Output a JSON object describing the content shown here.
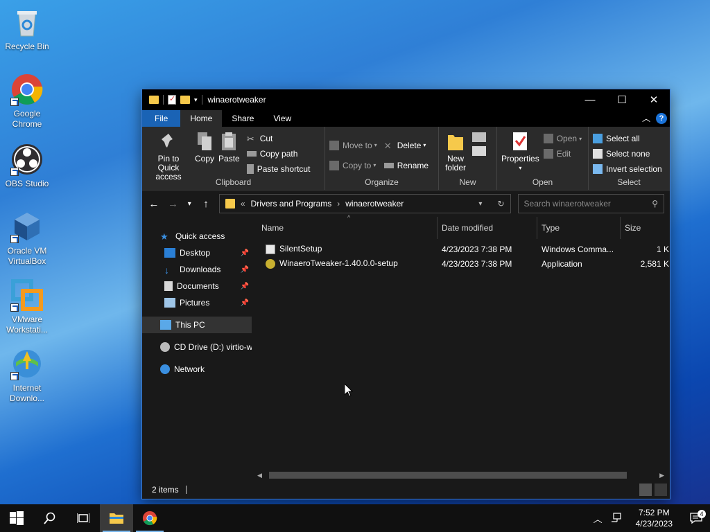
{
  "desktop": {
    "icons": [
      {
        "label": "Recycle Bin",
        "icon": "recycle-bin-icon"
      },
      {
        "label": "Google Chrome",
        "icon": "chrome-icon"
      },
      {
        "label": "OBS Studio",
        "icon": "obs-icon"
      },
      {
        "label": "Oracle VM VirtualBox",
        "icon": "virtualbox-icon"
      },
      {
        "label": "VMware Workstati...",
        "icon": "vmware-icon"
      },
      {
        "label": "Internet Downlo...",
        "icon": "idm-icon"
      }
    ]
  },
  "window": {
    "title": "winaerotweaker",
    "controls": {
      "minimize": "—",
      "maximize": "☐",
      "close": "✕"
    },
    "tabs": [
      "File",
      "Home",
      "Share",
      "View"
    ],
    "active_tab": "Home"
  },
  "ribbon": {
    "clipboard": {
      "label": "Clipboard",
      "pin": "Pin to Quick access",
      "copy": "Copy",
      "paste": "Paste",
      "cut": "Cut",
      "copy_path": "Copy path",
      "paste_shortcut": "Paste shortcut"
    },
    "organize": {
      "label": "Organize",
      "move_to": "Move to",
      "copy_to": "Copy to",
      "delete": "Delete",
      "rename": "Rename"
    },
    "new": {
      "label": "New",
      "new_folder": "New folder"
    },
    "open": {
      "label": "Open",
      "properties": "Properties",
      "open": "Open",
      "edit": "Edit"
    },
    "select": {
      "label": "Select",
      "select_all": "Select all",
      "select_none": "Select none",
      "invert_selection": "Invert selection"
    }
  },
  "address": {
    "prefix": "«",
    "crumbs": [
      "Drivers and Programs",
      "winaerotweaker"
    ],
    "search_placeholder": "Search winaerotweaker"
  },
  "nav": {
    "quick_access": "Quick access",
    "items": [
      {
        "label": "Desktop",
        "pinned": true
      },
      {
        "label": "Downloads",
        "pinned": true
      },
      {
        "label": "Documents",
        "pinned": true
      },
      {
        "label": "Pictures",
        "pinned": true
      }
    ],
    "this_pc": "This PC",
    "cd_drive": "CD Drive (D:) virtio-w",
    "network": "Network"
  },
  "files": {
    "columns": [
      "Name",
      "Date modified",
      "Type",
      "Size"
    ],
    "rows": [
      {
        "name": "SilentSetup",
        "date": "4/23/2023 7:38 PM",
        "type": "Windows Comma...",
        "size": "1 K"
      },
      {
        "name": "WinaeroTweaker-1.40.0.0-setup",
        "date": "4/23/2023 7:38 PM",
        "type": "Application",
        "size": "2,581 K"
      }
    ]
  },
  "status": {
    "items": "2 items"
  },
  "taskbar": {
    "time": "7:52 PM",
    "date": "4/23/2023",
    "notifications": "4"
  },
  "colors": {
    "accent": "#1a63b5",
    "window_bg": "#191919",
    "ribbon_bg": "#2b2b2b",
    "folder": "#f6c94b"
  }
}
